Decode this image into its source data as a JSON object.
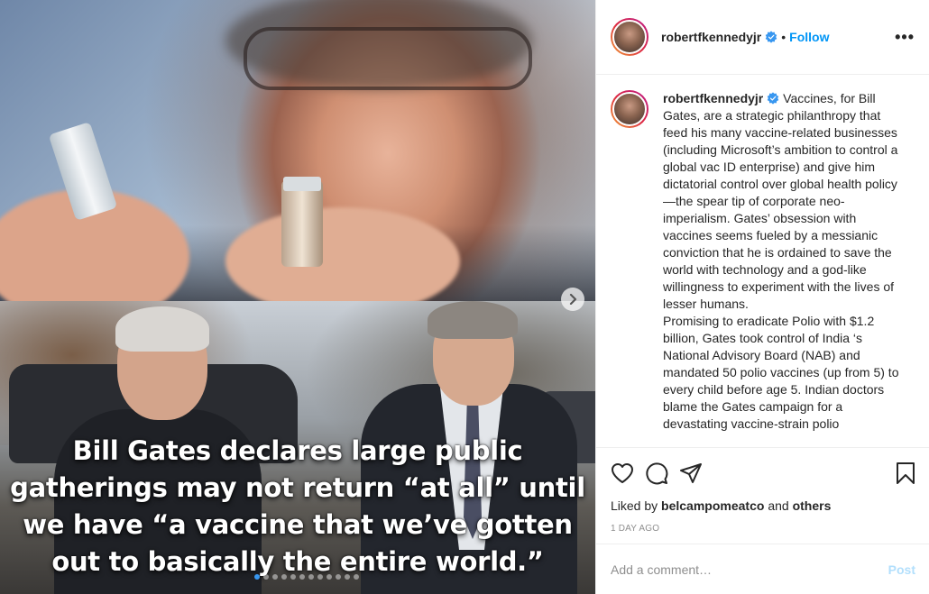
{
  "post": {
    "username": "robertfkennedyjr",
    "follow_label": "Follow",
    "separator": "•",
    "more_label": "•••",
    "media": {
      "overlay_quote": "Bill Gates declares large public gatherings may not return “at all” until we have “a vaccine that we’ve gotten out to basically the entire world.”",
      "carousel_count": 12,
      "carousel_active_index": 0
    },
    "caption": {
      "username": "robertfkennedyjr",
      "paragraphs": [
        "Vaccines, for Bill Gates, are a strategic philanthropy that feed his many vaccine-related businesses (including Microsoft’s ambition to control a global vac ID enterprise) and give him dictatorial control over global health policy—the spear tip of corporate neo-imperialism. Gates’ obsession with vaccines seems fueled by a messianic conviction that he is ordained to save the world with technology and a god-like willingness to experiment with the lives of lesser humans.",
        "Promising to eradicate Polio with $1.2 billion, Gates took control of India ‘s National Advisory Board (NAB) and mandated 50 polio vaccines (up from 5) to every child before age 5. Indian doctors blame the Gates campaign for a devastating vaccine-strain polio"
      ]
    },
    "likes": {
      "prefix": "Liked by",
      "user": "belcampomeatco",
      "conjunction": "and",
      "others": "others"
    },
    "timestamp": "1 DAY AGO",
    "comment": {
      "placeholder": "Add a comment…",
      "post_label": "Post"
    },
    "icons": {
      "like": "heart-icon",
      "comment": "comment-icon",
      "share": "share-icon",
      "save": "bookmark-icon",
      "next": "chevron-right-icon",
      "verified": "verified-badge-icon"
    },
    "colors": {
      "link_blue": "#0095f6",
      "verified_blue": "#3897f0",
      "post_disabled": "#b2dffc"
    }
  }
}
